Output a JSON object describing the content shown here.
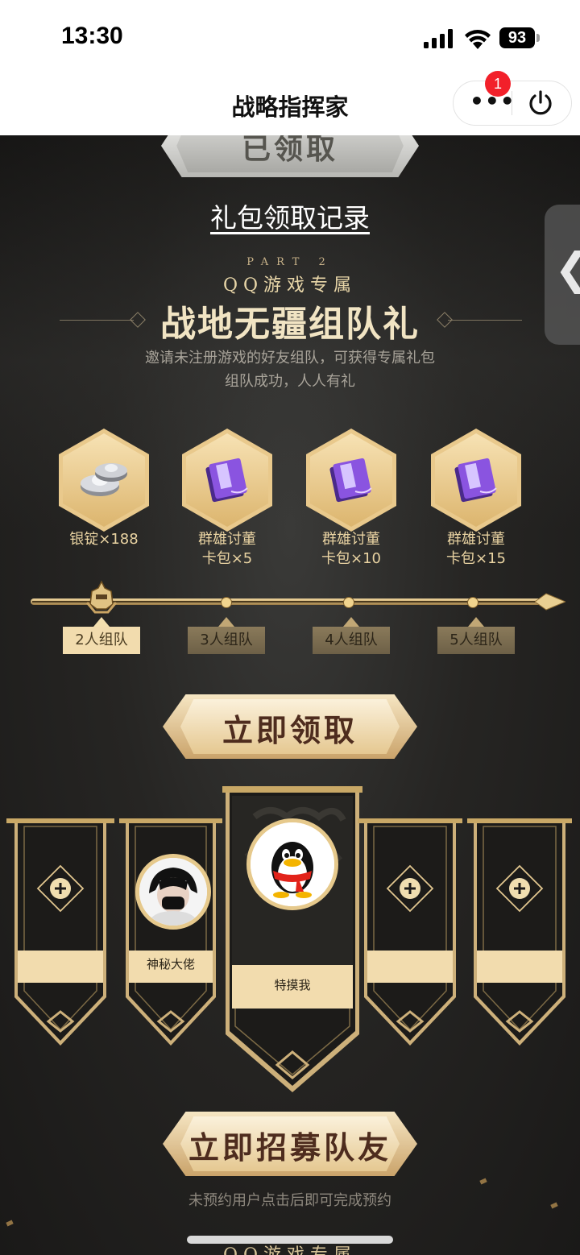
{
  "status_bar": {
    "time": "13:30",
    "battery": "93"
  },
  "header": {
    "title": "战略指挥家",
    "more_icon": "more-icon",
    "close_icon": "power-icon",
    "badge_count": "1"
  },
  "top": {
    "claimed_label": "已领取",
    "record_link": "礼包领取记录"
  },
  "side_tab": {
    "glyph": "❮"
  },
  "section": {
    "part": "PART 2",
    "subtitle": "QQ游戏专属",
    "title": "战地无疆组队礼",
    "desc_line1": "邀请未注册游戏的好友组队，可获得专属礼包",
    "desc_line2": "组队成功，人人有礼"
  },
  "rewards": [
    {
      "name_line1": "银锭×188",
      "name_line2": "",
      "icon": "silver-ingot-icon"
    },
    {
      "name_line1": "群雄讨董",
      "name_line2": "卡包×5",
      "icon": "card-pack-icon"
    },
    {
      "name_line1": "群雄讨董",
      "name_line2": "卡包×10",
      "icon": "card-pack-icon"
    },
    {
      "name_line1": "群雄讨董",
      "name_line2": "卡包×15",
      "icon": "card-pack-icon"
    }
  ],
  "progress": {
    "current_index": 0,
    "labels": [
      "2人组队",
      "3人组队",
      "4人组队",
      "5人组队"
    ]
  },
  "claim_button": "立即领取",
  "team": {
    "slots": [
      {
        "type": "empty"
      },
      {
        "type": "member",
        "name": "神秘大佬"
      },
      {
        "type": "leader",
        "name": "特摸我"
      },
      {
        "type": "empty"
      },
      {
        "type": "empty"
      }
    ]
  },
  "recruit_button": "立即招募队友",
  "recruit_note": "未预约用户点击后即可完成预约",
  "next_section_subtitle": "QQ游戏专属",
  "colors": {
    "gold": "#e9c98c",
    "badge": "#f2202a",
    "dark_bg": "#1d1c1a"
  }
}
